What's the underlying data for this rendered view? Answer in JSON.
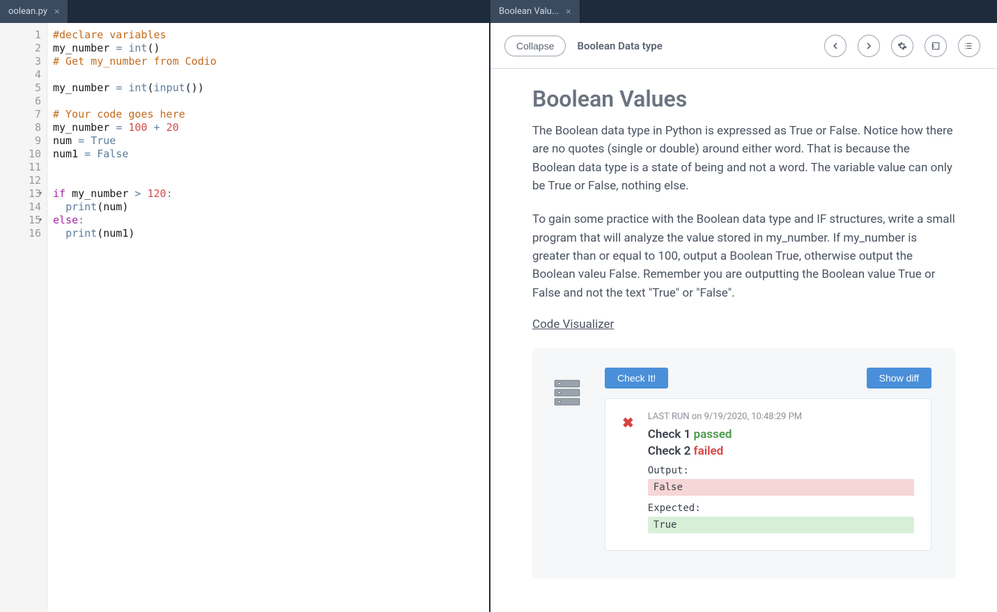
{
  "left": {
    "tab_label": "oolean.py",
    "lines": [
      {
        "n": "1",
        "fold": "",
        "tokens": [
          {
            "t": "#declare variables",
            "c": "tok-comment"
          }
        ]
      },
      {
        "n": "2",
        "fold": "",
        "tokens": [
          {
            "t": "my_number ",
            "c": "tok-ident"
          },
          {
            "t": "= ",
            "c": "tok-op"
          },
          {
            "t": "int",
            "c": "tok-builtin"
          },
          {
            "t": "()",
            "c": "tok-paren"
          }
        ]
      },
      {
        "n": "3",
        "fold": "",
        "tokens": [
          {
            "t": "# Get my_number from Codio",
            "c": "tok-comment"
          }
        ]
      },
      {
        "n": "4",
        "fold": "",
        "tokens": []
      },
      {
        "n": "5",
        "fold": "",
        "tokens": [
          {
            "t": "my_number ",
            "c": "tok-ident"
          },
          {
            "t": "= ",
            "c": "tok-op"
          },
          {
            "t": "int",
            "c": "tok-builtin"
          },
          {
            "t": "(",
            "c": "tok-paren"
          },
          {
            "t": "input",
            "c": "tok-builtin"
          },
          {
            "t": "())",
            "c": "tok-paren"
          }
        ]
      },
      {
        "n": "6",
        "fold": "",
        "tokens": []
      },
      {
        "n": "7",
        "fold": "",
        "tokens": [
          {
            "t": "# Your code goes here",
            "c": "tok-comment"
          }
        ]
      },
      {
        "n": "8",
        "fold": "",
        "tokens": [
          {
            "t": "my_number ",
            "c": "tok-ident"
          },
          {
            "t": "= ",
            "c": "tok-op"
          },
          {
            "t": "100",
            "c": "tok-num"
          },
          {
            "t": " + ",
            "c": "tok-op"
          },
          {
            "t": "20",
            "c": "tok-num"
          }
        ]
      },
      {
        "n": "9",
        "fold": "",
        "tokens": [
          {
            "t": "num ",
            "c": "tok-ident"
          },
          {
            "t": "= ",
            "c": "tok-op"
          },
          {
            "t": "True",
            "c": "tok-bool"
          }
        ]
      },
      {
        "n": "10",
        "fold": "",
        "tokens": [
          {
            "t": "num1 ",
            "c": "tok-ident"
          },
          {
            "t": "= ",
            "c": "tok-op"
          },
          {
            "t": "False",
            "c": "tok-bool"
          }
        ]
      },
      {
        "n": "11",
        "fold": "",
        "tokens": []
      },
      {
        "n": "12",
        "fold": "",
        "tokens": []
      },
      {
        "n": "13",
        "fold": "▾",
        "tokens": [
          {
            "t": "if",
            "c": "tok-keyword"
          },
          {
            "t": " my_number ",
            "c": "tok-ident"
          },
          {
            "t": "> ",
            "c": "tok-op"
          },
          {
            "t": "120",
            "c": "tok-num"
          },
          {
            "t": ":",
            "c": "tok-op"
          }
        ]
      },
      {
        "n": "14",
        "fold": "",
        "tokens": [
          {
            "t": "  ",
            "c": "tok-ident"
          },
          {
            "t": "print",
            "c": "tok-builtin"
          },
          {
            "t": "(num)",
            "c": "tok-paren"
          }
        ]
      },
      {
        "n": "15",
        "fold": "▾",
        "tokens": [
          {
            "t": "else",
            "c": "tok-keyword"
          },
          {
            "t": ":",
            "c": "tok-op"
          }
        ]
      },
      {
        "n": "16",
        "fold": "",
        "tokens": [
          {
            "t": "  ",
            "c": "tok-ident"
          },
          {
            "t": "print",
            "c": "tok-builtin"
          },
          {
            "t": "(num1)",
            "c": "tok-paren"
          }
        ]
      }
    ]
  },
  "right": {
    "tab_label": "Boolean Valu...",
    "collapse_label": "Collapse",
    "toolbar_title": "Boolean Data type",
    "heading": "Boolean Values",
    "para1": "The Boolean data type in Python is expressed as True or False. Notice how there are no quotes (single or double) around either word. That is because the Boolean data type is a state of being and not a word. The variable value can only be True or False, nothing else.",
    "para2": "To gain some practice with the Boolean data type and IF structures, write a small program that will analyze the value stored in my_number. If my_number is greater than or equal to 100, output a Boolean True, otherwise output the Boolean valeu False. Remember you are outputting the Boolean value True or False and not the text \"True\" or \"False\".",
    "cv_link": "Code Visualizer",
    "check_it_label": "Check It!",
    "show_diff_label": "Show diff",
    "lastrun_prefix": "LAST RUN on ",
    "lastrun_time": "9/19/2020, 10:48:29 PM",
    "check1_label": "Check 1 ",
    "check1_status": "passed",
    "check2_label": "Check 2 ",
    "check2_status": "failed",
    "output_label": "Output:",
    "output_value": "False",
    "expected_label": "Expected:",
    "expected_value": "True"
  }
}
